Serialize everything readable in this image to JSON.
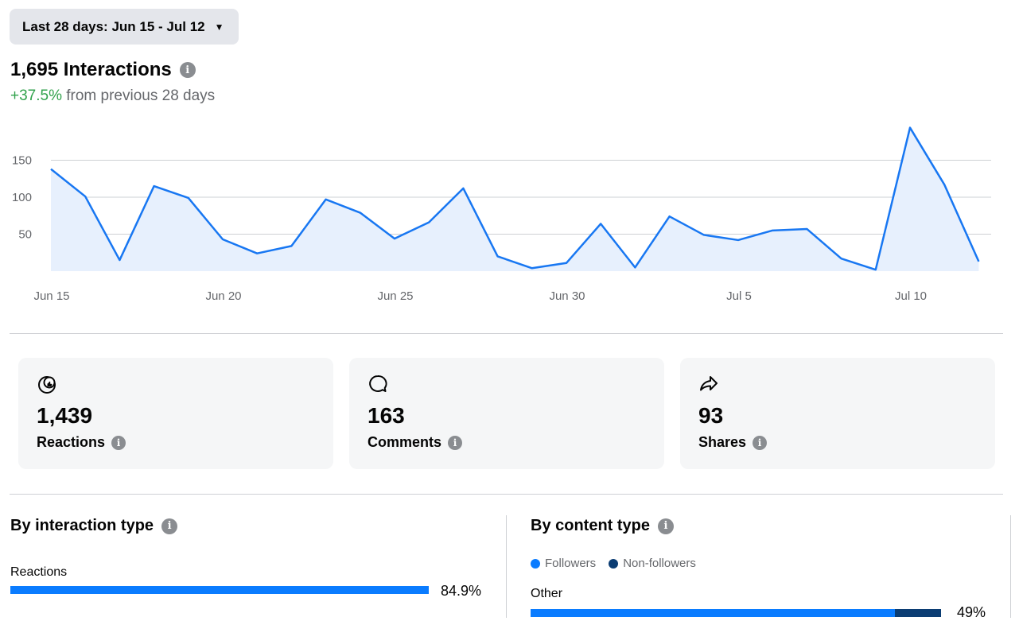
{
  "date_range": {
    "label": "Last 28 days: Jun 15 - Jul 12"
  },
  "summary": {
    "total": "1,695 Interactions",
    "change": "+37.5%",
    "change_suffix": " from previous 28 days"
  },
  "chart_data": {
    "type": "area",
    "x_tick_labels": [
      "Jun 15",
      "Jun 20",
      "Jun 25",
      "Jun 30",
      "Jul 5",
      "Jul 10"
    ],
    "y_tick_labels": [
      "150",
      "100",
      "50"
    ],
    "ylim": [
      0,
      150
    ],
    "grid": true,
    "series": [
      {
        "values": [
          138,
          101,
          15,
          115,
          99,
          43,
          24,
          34,
          97,
          79,
          44,
          66,
          112,
          20,
          4,
          11,
          64,
          5,
          74,
          49,
          42,
          55,
          57,
          17,
          2,
          194,
          117,
          13
        ]
      }
    ]
  },
  "metrics": [
    {
      "value": "1,439",
      "label": "Reactions"
    },
    {
      "value": "163",
      "label": "Comments"
    },
    {
      "value": "93",
      "label": "Shares"
    }
  ],
  "by_interaction_type": {
    "title": "By interaction type",
    "rows": [
      {
        "label": "Reactions",
        "pct": "84.9%",
        "fraction": 0.849
      }
    ]
  },
  "by_content_type": {
    "title": "By content type",
    "legend": [
      "Followers",
      "Non-followers"
    ],
    "rows": [
      {
        "label": "Other",
        "pct": "49%",
        "followers_fraction": 0.887
      }
    ]
  },
  "colors": {
    "line": "#1877f2",
    "area": "#e7f0fd",
    "followers": "#0a7cff",
    "non_followers": "#0b3d73",
    "positive": "#31a24c"
  },
  "icons": {
    "dropdown": "triangle-down",
    "info": "info-circle",
    "reactions": "reaction-thumb",
    "comments": "speech-bubble",
    "shares": "share-arrow"
  }
}
